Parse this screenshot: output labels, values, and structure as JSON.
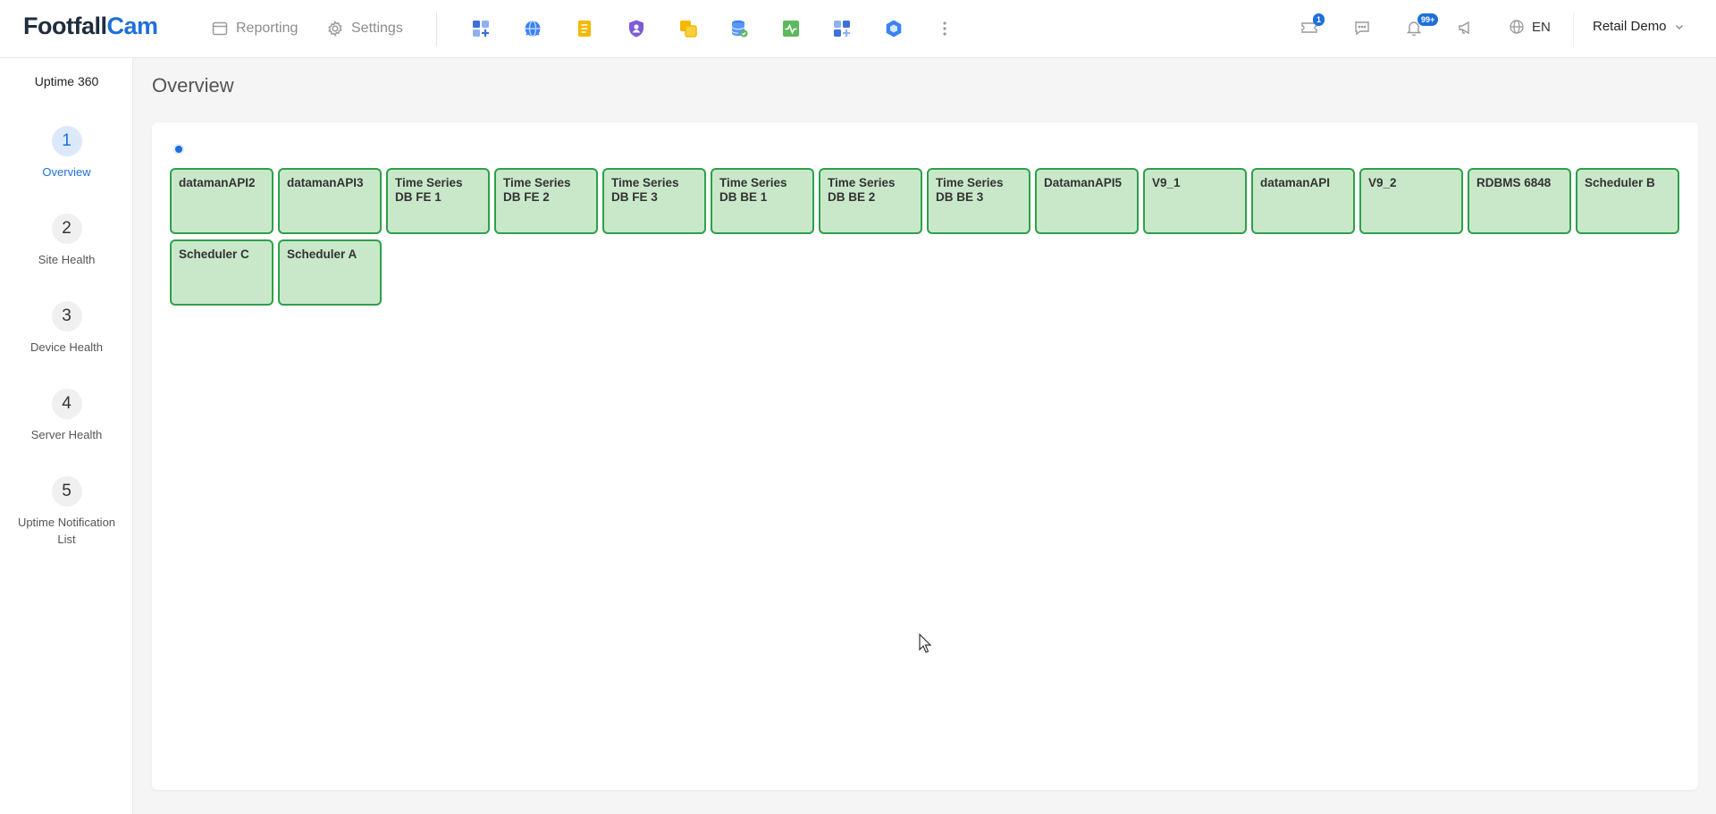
{
  "brand": {
    "part1": "Footfall",
    "part2": "Cam"
  },
  "nav": {
    "reporting": "Reporting",
    "settings": "Settings"
  },
  "app_icons": [
    {
      "name": "dashboard-add-icon",
      "color": "#4a7fe0"
    },
    {
      "name": "globe-icon",
      "color": "#3b82f6"
    },
    {
      "name": "notes-icon",
      "color": "#f5b800"
    },
    {
      "name": "shield-user-icon",
      "color": "#7c5cd6"
    },
    {
      "name": "copy-icon",
      "color": "#f5b800"
    },
    {
      "name": "database-check-icon",
      "color": "#3b82f6"
    },
    {
      "name": "activity-icon",
      "color": "#5cb85c"
    },
    {
      "name": "grid-add-icon",
      "color": "#4a7fe0"
    },
    {
      "name": "hexagon-icon",
      "color": "#3b82f6"
    },
    {
      "name": "more-vertical-icon",
      "color": "#999999"
    }
  ],
  "header_right": {
    "ticket_badge": "1",
    "notification_badge": "99+",
    "language": "EN",
    "account": "Retail Demo"
  },
  "sidebar": {
    "title": "Uptime 360",
    "steps": [
      {
        "number": "1",
        "label": "Overview",
        "active": true
      },
      {
        "number": "2",
        "label": "Site Health"
      },
      {
        "number": "3",
        "label": "Device Health"
      },
      {
        "number": "4",
        "label": "Server Health"
      },
      {
        "number": "5",
        "label": "Uptime Notification List"
      }
    ]
  },
  "main": {
    "title": "Overview",
    "tiles": [
      "datamanAPI2",
      "datamanAPI3",
      "Time Series DB FE 1",
      "Time Series DB FE 2",
      "Time Series DB FE 3",
      "Time Series DB BE 1",
      "Time Series DB BE 2",
      "Time Series DB BE 3",
      "DatamanAPI5",
      "V9_1",
      "datamanAPI",
      "V9_2",
      "RDBMS 6848",
      "Scheduler B",
      "Scheduler C",
      "Scheduler A"
    ]
  },
  "colors": {
    "accent": "#1e6fd9",
    "tile_bg": "#c9e8ca",
    "tile_border": "#2ea04a"
  }
}
